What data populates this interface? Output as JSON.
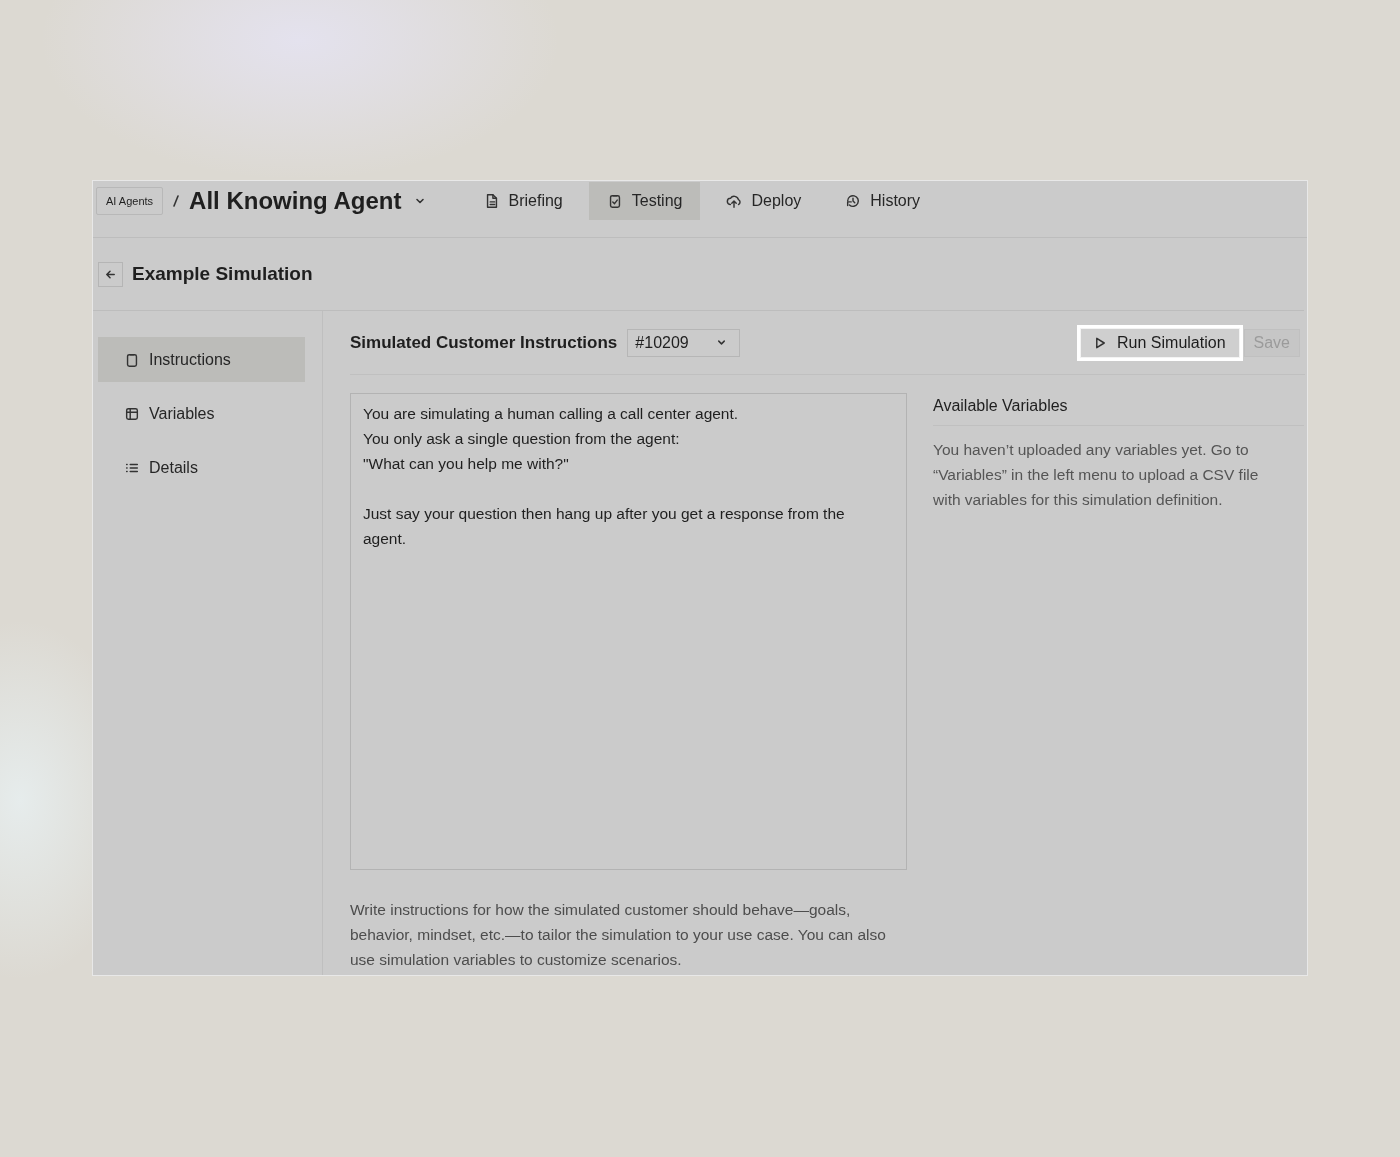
{
  "breadcrumb": {
    "label": "AI Agents"
  },
  "agent": {
    "name": "All Knowing Agent"
  },
  "tabs": [
    {
      "label": "Briefing",
      "kind": "document",
      "selected": false
    },
    {
      "label": "Testing",
      "kind": "clipboard",
      "selected": true
    },
    {
      "label": "Deploy",
      "kind": "upload",
      "selected": false
    },
    {
      "label": "History",
      "kind": "history",
      "selected": false
    }
  ],
  "page": {
    "title": "Example Simulation"
  },
  "sidebar": {
    "items": [
      {
        "label": "Instructions",
        "kind": "clipboard",
        "selected": true
      },
      {
        "label": "Variables",
        "kind": "table",
        "selected": false
      },
      {
        "label": "Details",
        "kind": "list",
        "selected": false
      }
    ]
  },
  "instructions": {
    "label": "Simulated Customer Instructions",
    "version": "#10209",
    "value": "You are simulating a human calling a call center agent.\nYou only ask a single question from the agent:\n\"What can you help me with?\"\n\nJust say your question then hang up after you get a response from the agent.",
    "help": "Write instructions for how the simulated customer should behave—goals, behavior, mindset, etc.—to tailor the simulation to your use case. You can also use simulation variables to customize scenarios."
  },
  "actions": [
    {
      "label": "Run Simulation",
      "kind": "run",
      "disabled": false
    },
    {
      "label": "Save",
      "kind": "save",
      "disabled": true
    }
  ],
  "variables_panel": {
    "title": "Available Variables",
    "message": "You haven’t uploaded any variables yet. Go to “Variables” in the left menu to upload a CSV file with variables for this simulation definition."
  }
}
